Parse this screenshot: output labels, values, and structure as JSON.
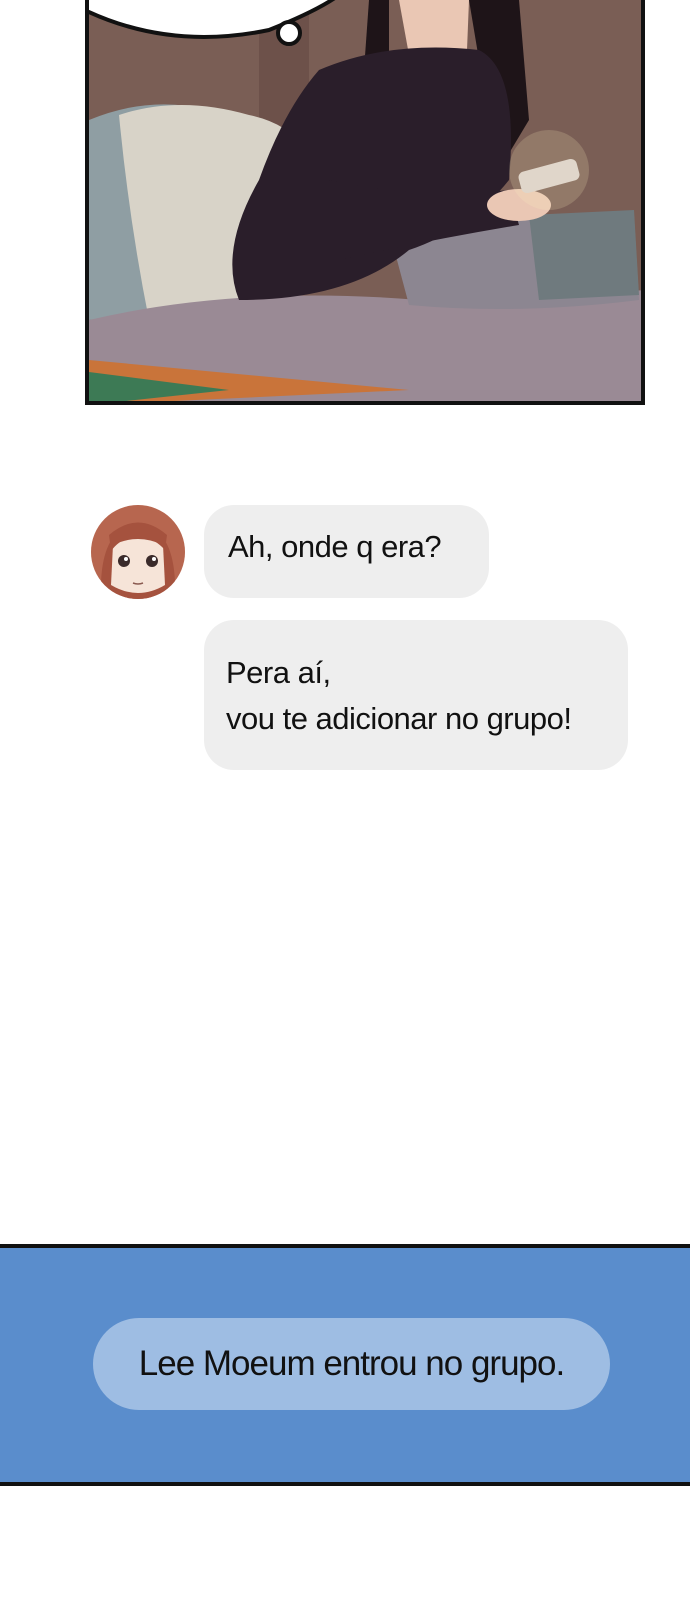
{
  "chat": {
    "messages": [
      {
        "sender": "avatar",
        "lines": [
          "Ah, onde q era?"
        ]
      },
      {
        "sender": "avatar",
        "lines": [
          "Pera aí,",
          "vou te adicionar no grupo!"
        ]
      }
    ]
  },
  "system_notice": {
    "text": "Lee Moeum entrou no grupo."
  },
  "colors": {
    "bubble": "#eeeeee",
    "band": "#5a8dcc",
    "pill": "#9ebde3",
    "panel_wall": "#7a5e55",
    "bed": "#9a8a95"
  }
}
